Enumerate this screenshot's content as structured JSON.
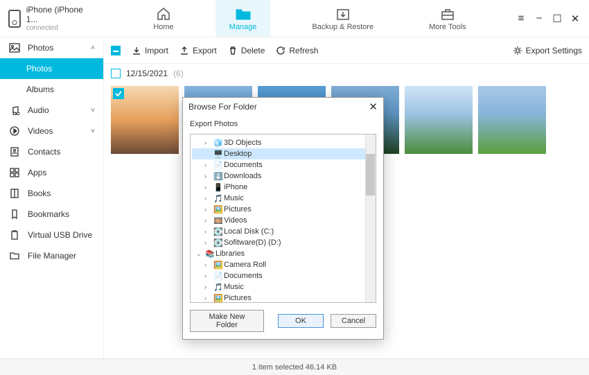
{
  "device": {
    "name": "iPhone (iPhone 1...",
    "status": "connected"
  },
  "nav": {
    "home": "Home",
    "manage": "Manage",
    "backup": "Backup & Restore",
    "tools": "More Tools"
  },
  "sidebar": {
    "photos": "Photos",
    "photos_sub_photos": "Photos",
    "photos_sub_albums": "Albums",
    "audio": "Audio",
    "videos": "Videos",
    "contacts": "Contacts",
    "apps": "Apps",
    "books": "Books",
    "bookmarks": "Bookmarks",
    "usb": "Virtual USB Drive",
    "fm": "File Manager"
  },
  "toolbar": {
    "import": "Import",
    "export": "Export",
    "delete": "Delete",
    "refresh": "Refresh",
    "exportSettings": "Export Settings"
  },
  "group": {
    "date": "12/15/2021",
    "count": "(6)"
  },
  "status": "1 item selected 46.14 KB",
  "dialog": {
    "title": "Browse For Folder",
    "subtitle": "Export Photos",
    "makeNew": "Make New Folder",
    "ok": "OK",
    "cancel": "Cancel",
    "tree": {
      "objects3d": "3D Objects",
      "desktop": "Desktop",
      "documents": "Documents",
      "downloads": "Downloads",
      "iphone": "iPhone",
      "music": "Music",
      "pictures": "Pictures",
      "videos": "Videos",
      "localc": "Local Disk (C:)",
      "softd": "Sofitware(D) (D:)",
      "libraries": "Libraries",
      "camroll": "Camera Roll",
      "documents2": "Documents",
      "music2": "Music",
      "pictures2": "Pictures"
    }
  }
}
